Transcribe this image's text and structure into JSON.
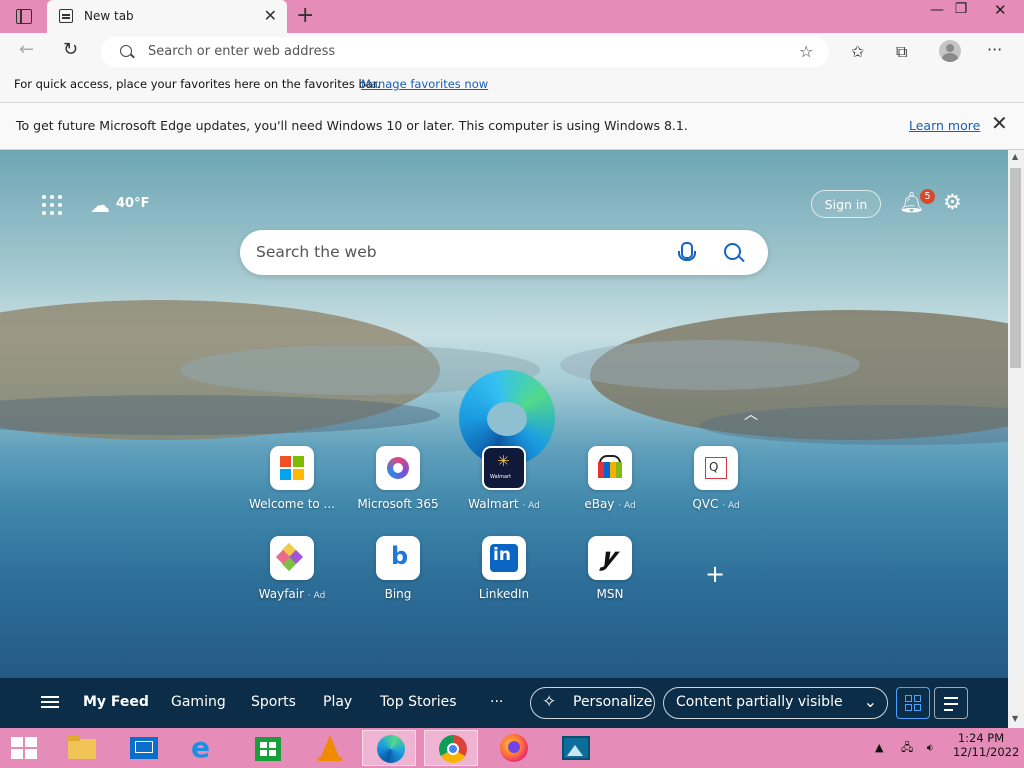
{
  "browser": {
    "tab_title": "New tab",
    "address_placeholder": "Search or enter web address"
  },
  "favorites_bar": {
    "message": "For quick access, place your favorites here on the favorites bar.",
    "link": "Manage favorites now"
  },
  "info_bar": {
    "message": "To get future Microsoft Edge updates, you'll need Windows 10 or later. This computer is using Windows 8.1.",
    "link": "Learn more"
  },
  "newtab": {
    "temperature": "40°F",
    "sign_in": "Sign in",
    "notification_count": "5",
    "search_placeholder": "Search the web",
    "tiles": [
      {
        "label": "Welcome to ...",
        "ad": ""
      },
      {
        "label": "Microsoft 365",
        "ad": ""
      },
      {
        "label": "Walmart",
        "ad": "· Ad"
      },
      {
        "label": "eBay",
        "ad": "· Ad"
      },
      {
        "label": "QVC",
        "ad": "· Ad"
      },
      {
        "label": "Wayfair",
        "ad": "· Ad"
      },
      {
        "label": "Bing",
        "ad": ""
      },
      {
        "label": "LinkedIn",
        "ad": ""
      },
      {
        "label": "MSN",
        "ad": ""
      }
    ],
    "walmart_logo_text": "Walmart",
    "feed": {
      "items": [
        "My Feed",
        "Gaming",
        "Sports",
        "Play",
        "Top Stories"
      ],
      "more": "···",
      "personalize": "Personalize",
      "content_visibility": "Content partially visible"
    }
  },
  "taskbar": {
    "time": "1:24 PM",
    "date": "12/11/2022"
  }
}
